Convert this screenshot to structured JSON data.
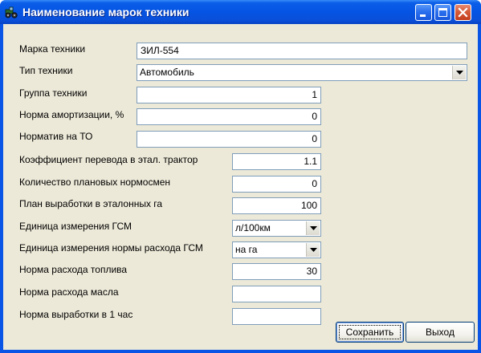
{
  "window": {
    "title": "Наименование марок техники",
    "icon": "tractor-app-icon",
    "controls": [
      "minimize-icon",
      "maximize-icon",
      "close-icon"
    ]
  },
  "form": {
    "brand": {
      "label": "Марка техники",
      "value": "ЗИЛ-554"
    },
    "type": {
      "label": "Тип техники",
      "value": "Автомобиль"
    },
    "group": {
      "label": "Группа техники",
      "value": "1"
    },
    "amortization": {
      "label": "Норма амортизации, %",
      "value": "0"
    },
    "to_norm": {
      "label": "Норматив на ТО",
      "value": "0"
    },
    "coef": {
      "label": "Коэффициент перевода в этал. трактор",
      "value": "1.1"
    },
    "shifts": {
      "label": "Количество плановых нормосмен",
      "value": "0"
    },
    "plan": {
      "label": "План выработки в эталонных га",
      "value": "100"
    },
    "fuel_unit": {
      "label": "Единица измерения ГСМ",
      "value": "л/100км"
    },
    "rate_unit": {
      "label": "Единица измерения нормы расхода ГСМ",
      "value": "на га"
    },
    "fuel_rate": {
      "label": "Норма расхода топлива",
      "value": "30"
    },
    "oil_rate": {
      "label": "Норма расхода масла",
      "value": ""
    },
    "hour_rate": {
      "label": "Норма выработки в 1 час",
      "value": ""
    }
  },
  "buttons": {
    "save": "Сохранить",
    "exit": "Выход"
  }
}
